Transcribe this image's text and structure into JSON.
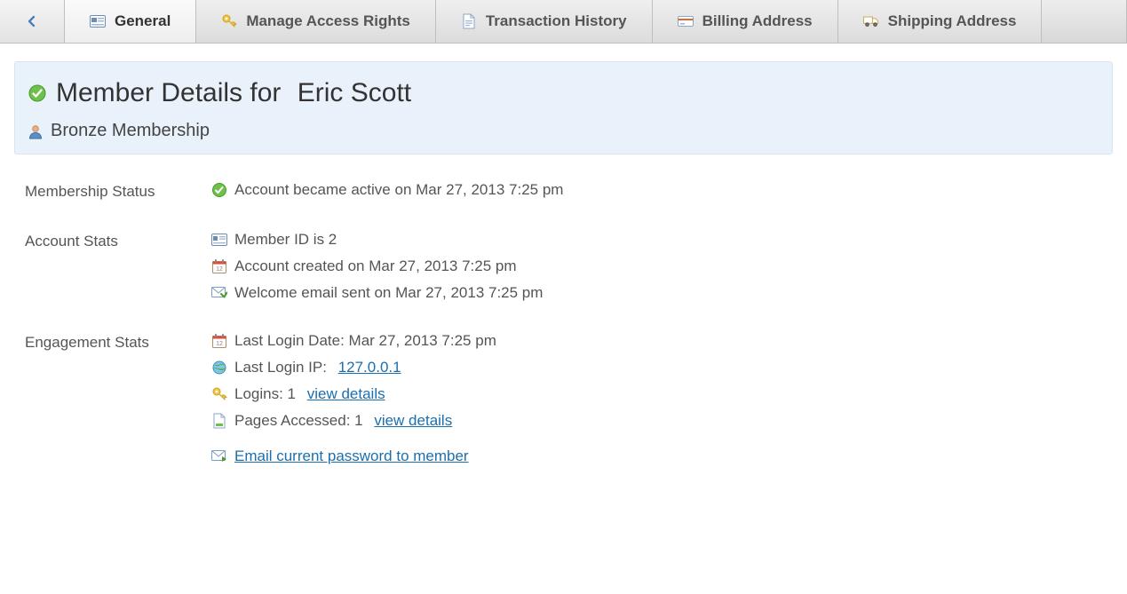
{
  "tabs": {
    "general": "General",
    "access_rights": "Manage Access Rights",
    "transactions": "Transaction History",
    "billing": "Billing Address",
    "shipping": "Shipping Address"
  },
  "header": {
    "title_prefix": "Member Details for ",
    "member_name": "Eric Scott",
    "membership_level": "Bronze Membership"
  },
  "labels": {
    "membership_status": "Membership Status",
    "account_stats": "Account Stats",
    "engagement_stats": "Engagement Stats"
  },
  "status": {
    "active_text": "Account became active on Mar 27, 2013 7:25 pm"
  },
  "account": {
    "member_id_text": "Member ID is 2",
    "created_text": "Account created on Mar 27, 2013 7:25 pm",
    "welcome_email_text": "Welcome email sent on Mar 27, 2013 7:25 pm"
  },
  "engagement": {
    "last_login_text": "Last Login Date: Mar 27, 2013 7:25 pm",
    "last_login_ip_label": "Last Login IP: ",
    "last_login_ip": "127.0.0.1",
    "logins_label": "Logins: 1 ",
    "pages_label": "Pages Accessed: 1 ",
    "view_details": "view details"
  },
  "actions": {
    "email_password": "Email current password to member"
  }
}
